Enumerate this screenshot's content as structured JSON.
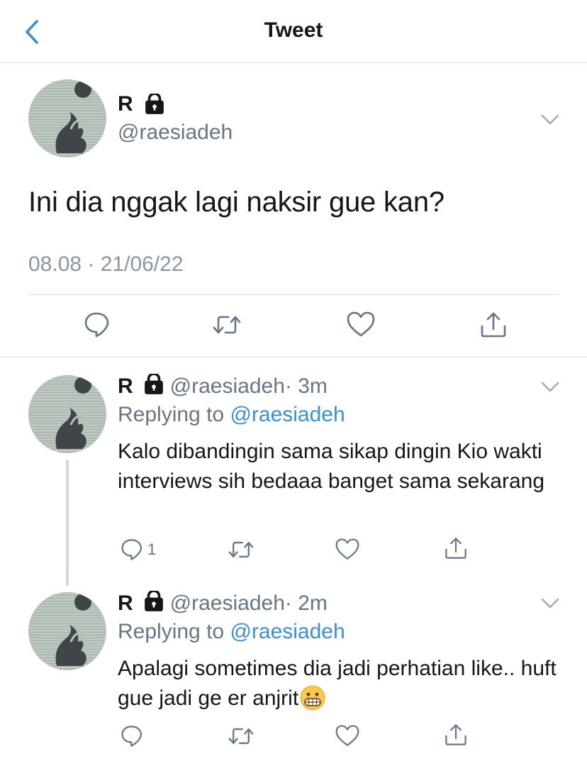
{
  "nav": {
    "title": "Tweet",
    "back_icon": "chevron-left-icon"
  },
  "colors": {
    "accent": "#3a8fd9",
    "secondary_text": "#657786",
    "primary_text": "#14171a",
    "divider": "#dadde0"
  },
  "main_tweet": {
    "name": "R",
    "handle": "@raesiadeh",
    "text": "Ini dia nggak lagi naksir gue kan?",
    "timestamp": "08.08 · 21/06/22",
    "actions": [
      "reply-icon",
      "retweet-icon",
      "like-icon",
      "share-icon"
    ]
  },
  "replies": [
    {
      "name": "R",
      "handle": "@raesiadeh",
      "time": "· 3m",
      "replying_prefix": "Replying to",
      "replying_to": "@raesiadeh",
      "text": "Kalo dibandingin sama sikap dingin Kio wakti interviews sih bedaaa banget sama sekarang",
      "reply_count": "1"
    },
    {
      "name": "R",
      "handle": "@raesiadeh",
      "time": "· 2m",
      "replying_prefix": "Replying to",
      "replying_to": "@raesiadeh",
      "text": "Apalagi sometimes dia jadi perhatian like.. huft gue jadi ge er anjrit",
      "emoji": "grimacing-face-icon"
    }
  ]
}
